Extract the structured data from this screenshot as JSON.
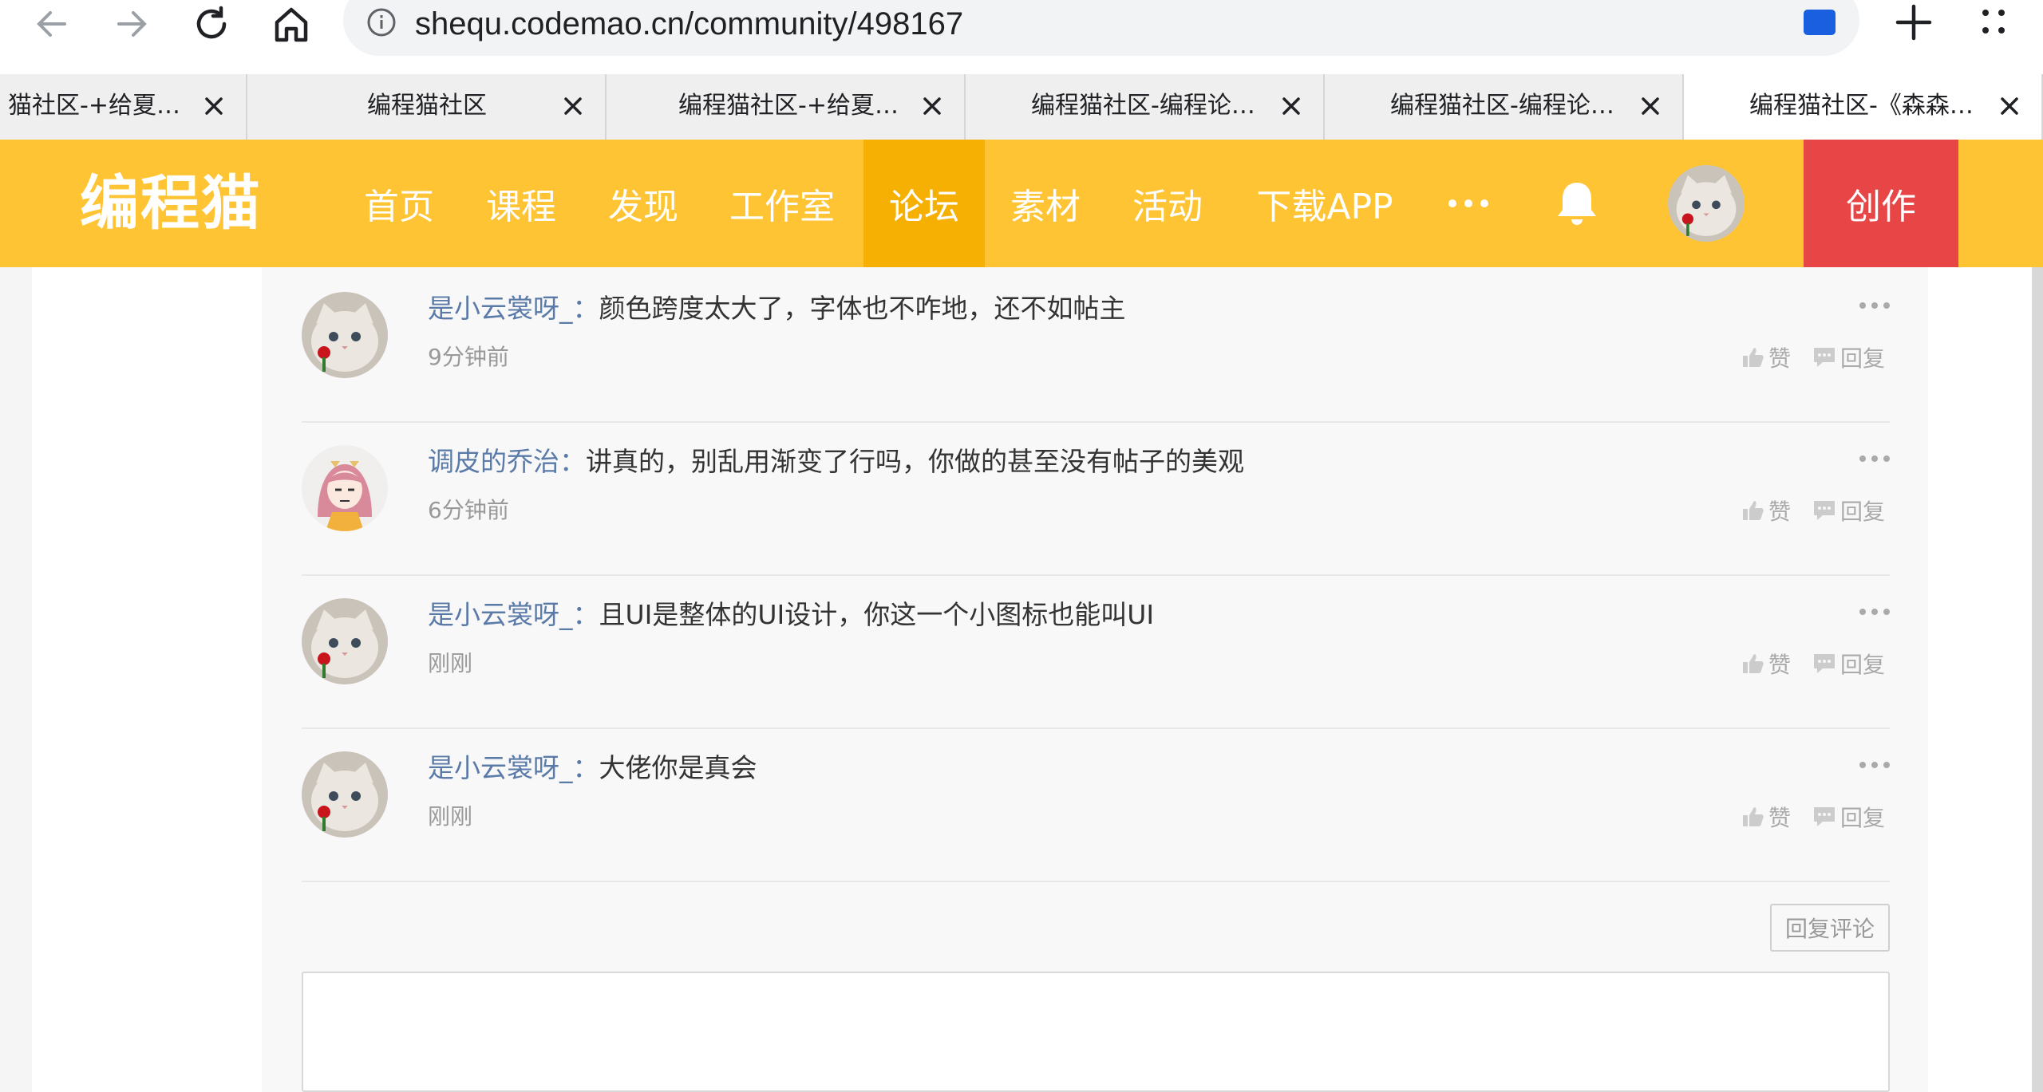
{
  "browser": {
    "url": "shequ.codemao.cn/community/498167",
    "tabs": [
      {
        "title": "猫社区-+给夏…"
      },
      {
        "title": "编程猫社区"
      },
      {
        "title": "编程猫社区-+给夏…"
      },
      {
        "title": "编程猫社区-编程论…"
      },
      {
        "title": "编程猫社区-编程论…"
      },
      {
        "title": "编程猫社区-《森森…"
      }
    ],
    "active_tab": 5
  },
  "header": {
    "logo": "编程猫",
    "nav": [
      "首页",
      "课程",
      "发现",
      "工作室",
      "论坛",
      "素材",
      "活动",
      "下载APP"
    ],
    "active_nav": "论坛",
    "create_label": "创作"
  },
  "comments": [
    {
      "user": "是小云裳呀_",
      "colon": "：",
      "text": "颜色跨度太大了，字体也不咋地，还不如帖主",
      "time": "9分钟前",
      "like": "赞",
      "reply": "回复",
      "avatar": "cat"
    },
    {
      "user": "调皮的乔治",
      "colon": "：",
      "text": "讲真的，别乱用渐变了行吗，你做的甚至没有帖子的美观",
      "time": "6分钟前",
      "like": "赞",
      "reply": "回复",
      "avatar": "anime-girl"
    },
    {
      "user": "是小云裳呀_",
      "colon": "：",
      "text": "且UI是整体的UI设计，你这一个小图标也能叫UI",
      "time": "刚刚",
      "like": "赞",
      "reply": "回复",
      "avatar": "cat"
    },
    {
      "user": "是小云裳呀_",
      "colon": "：",
      "text": "大佬你是真会",
      "time": "刚刚",
      "like": "赞",
      "reply": "回复",
      "avatar": "cat"
    }
  ],
  "reply_comment_label": "回复评论",
  "colors": {
    "header_bg": "#fec433",
    "header_active": "#f5b003",
    "create_bg": "#e84546",
    "username": "#5a7aa8"
  }
}
